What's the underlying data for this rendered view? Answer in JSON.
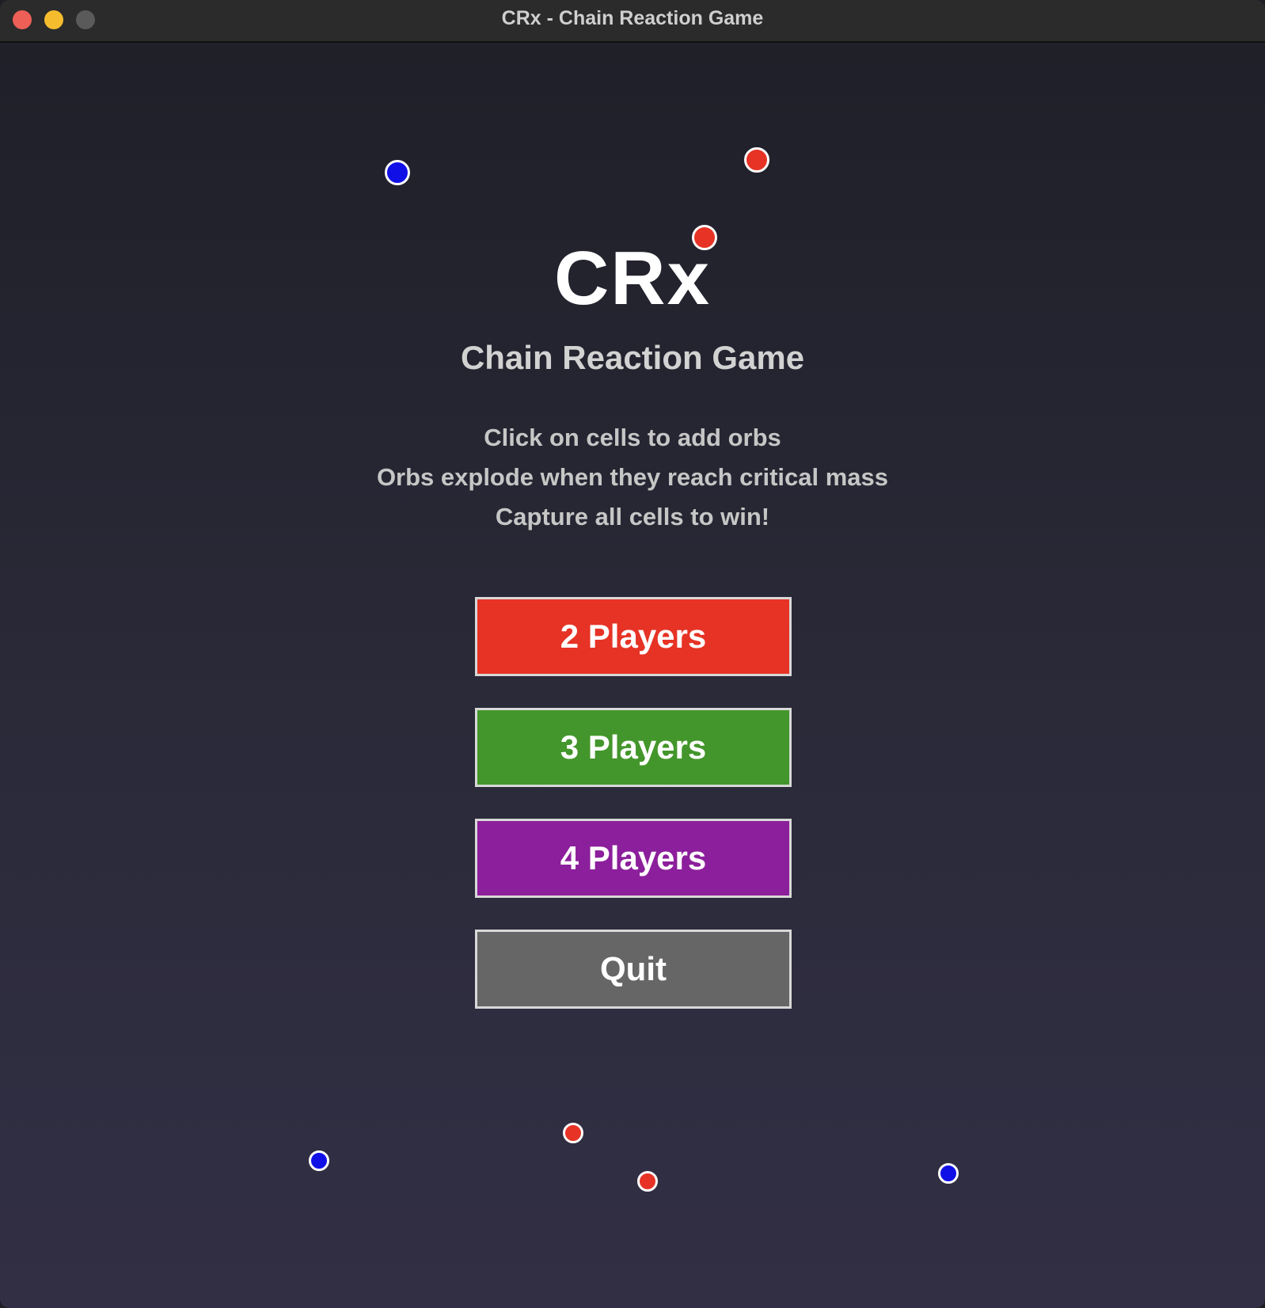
{
  "window": {
    "title": "CRx - Chain Reaction Game"
  },
  "menu": {
    "logo": "CRx",
    "subtitle": "Chain Reaction Game",
    "instructions": [
      "Click on cells to add orbs",
      "Orbs explode when they reach critical mass",
      "Capture all cells to win!"
    ],
    "buttons": {
      "two_players": "2 Players",
      "three_players": "3 Players",
      "four_players": "4 Players",
      "quit": "Quit"
    }
  },
  "colors": {
    "player_red": "#e63325",
    "player_green": "#43962b",
    "player_purple": "#8c1f9b",
    "player_blue": "#1010e6",
    "quit_gray": "#666666"
  }
}
